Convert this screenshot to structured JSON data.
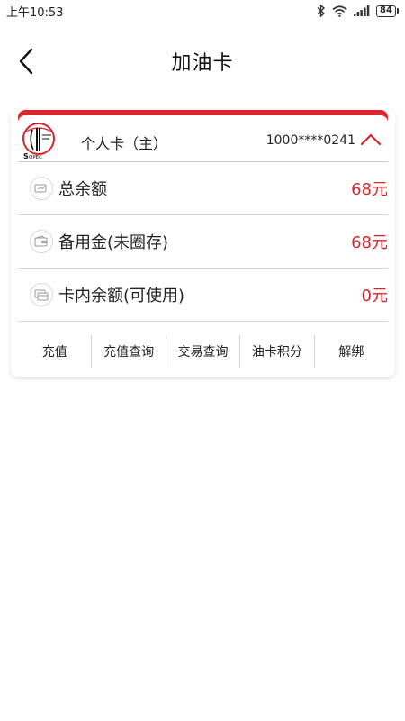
{
  "status_bar": {
    "time": "上午10:53",
    "battery": "84",
    "icons": [
      "bluetooth-icon",
      "wifi-icon",
      "signal-icon",
      "battery-icon"
    ]
  },
  "nav": {
    "title": "加油卡",
    "back_icon": "chevron-left-icon"
  },
  "card": {
    "name": "个人卡（主）",
    "number": "1000****0241",
    "logo_icon": "sinopec-logo-icon",
    "collapse_icon": "chevron-up-icon",
    "accent_color": "#e0262b",
    "rows": [
      {
        "label": "总余额",
        "value": "68元",
        "icon": "balance-icon"
      },
      {
        "label": "备用金(未圈存)",
        "value": "68元",
        "icon": "wallet-icon"
      },
      {
        "label": "卡内余额(可使用)",
        "value": "0元",
        "icon": "card-icon"
      }
    ],
    "actions": [
      {
        "label": "充值"
      },
      {
        "label": "充值查询"
      },
      {
        "label": "交易查询"
      },
      {
        "label": "油卡积分"
      },
      {
        "label": "解绑"
      }
    ]
  },
  "colors": {
    "value_red": "#d9232b",
    "divider": "#d6d6d6"
  }
}
